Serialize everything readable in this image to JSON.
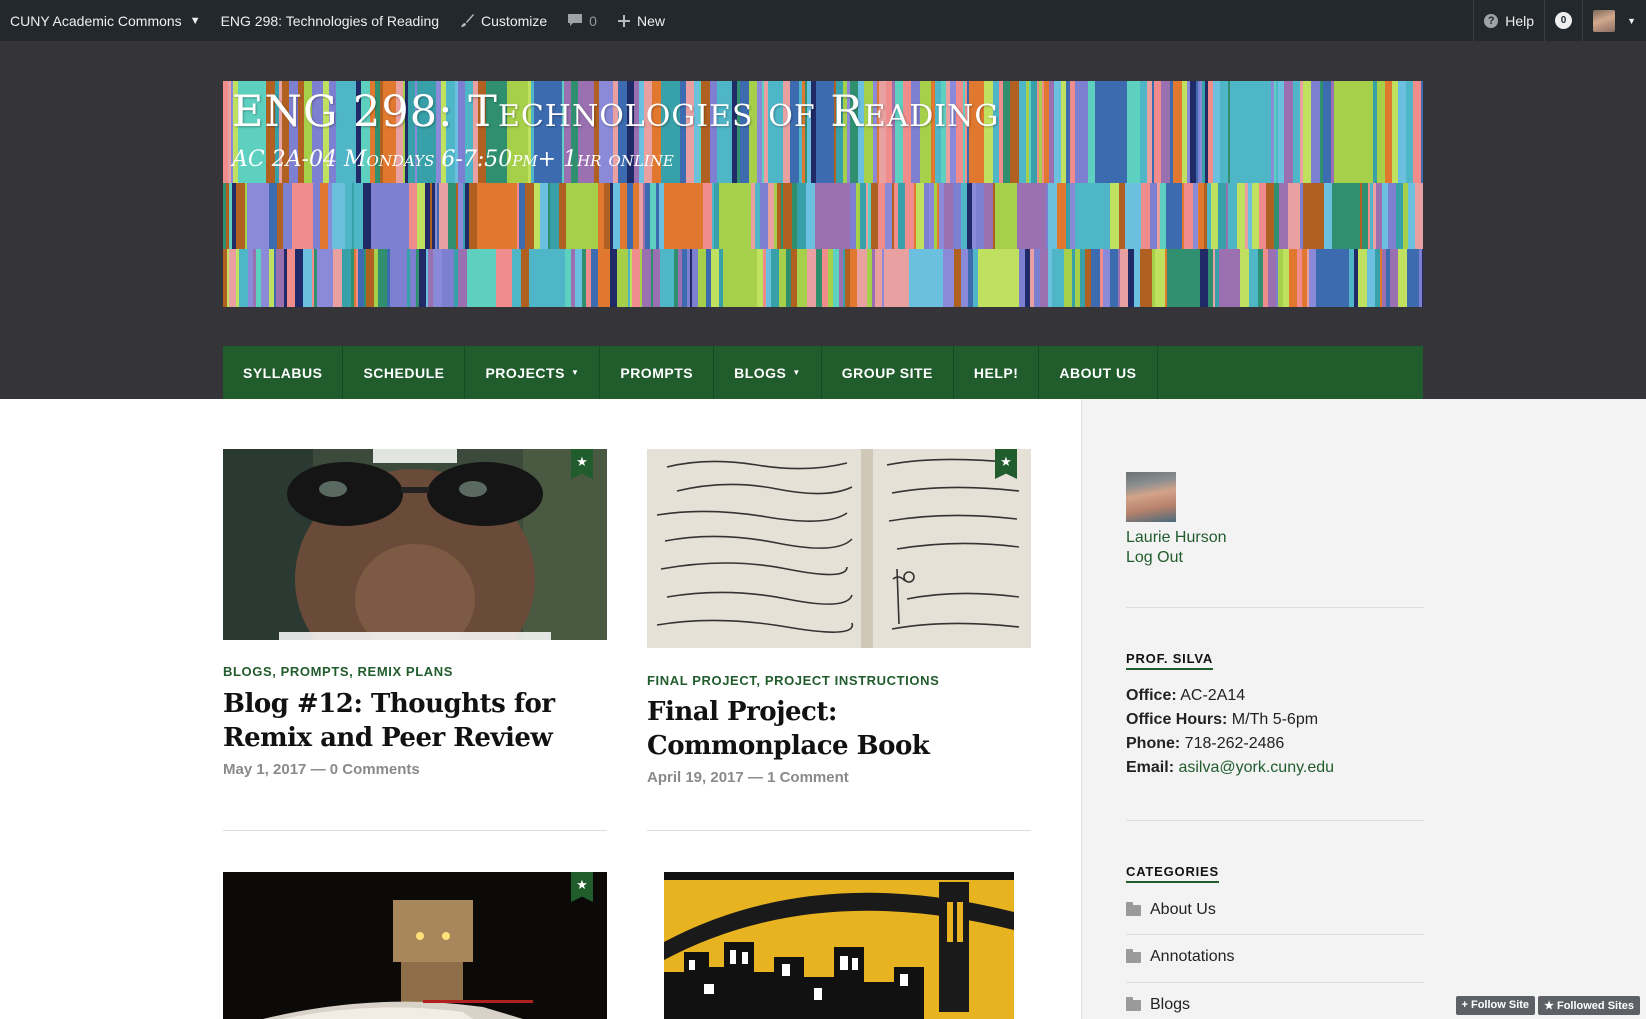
{
  "adminbar": {
    "site_name": "CUNY Academic Commons",
    "course_link": "ENG 298: Technologies of Reading",
    "customize": "Customize",
    "comments_count": "0",
    "new": "New",
    "help": "Help",
    "notifications_count": "0"
  },
  "header": {
    "title": "ENG 298: Technologies of Reading",
    "description": "AC 2A-04 Mondays 6-7:50pm+ 1hr online"
  },
  "nav": {
    "items": [
      {
        "label": "SYLLABUS"
      },
      {
        "label": "SCHEDULE"
      },
      {
        "label": "PROJECTS"
      },
      {
        "label": "PROMPTS"
      },
      {
        "label": "BLOGS"
      },
      {
        "label": "GROUP SITE"
      },
      {
        "label": "HELP!"
      },
      {
        "label": "ABOUT US"
      }
    ]
  },
  "posts": [
    {
      "categories": "BLOGS, PROMPTS, REMIX PLANS",
      "title": "Blog #12: Thoughts for Remix and Peer Review",
      "date": "May 1, 2017",
      "comments": "0 Comments"
    },
    {
      "categories": "FINAL PROJECT, PROJECT INSTRUCTIONS",
      "title": "Final Project: Commonplace Book",
      "date": "April 19, 2017",
      "comments": "1 Comment"
    }
  ],
  "sidebar": {
    "user_name": "Laurie Hurson",
    "logout": "Log Out",
    "prof_title": "PROF. SILVA",
    "office_label": "Office:",
    "office_value": "AC-2A14",
    "hours_label": "Office Hours:",
    "hours_value": "M/Th 5-6pm",
    "phone_label": "Phone:",
    "phone_value": "718-262-2486",
    "email_label": "Email:",
    "email_value": "asilva@york.cuny.edu",
    "categories_title": "CATEGORIES",
    "categories": [
      "About Us",
      "Annotations",
      "Blogs"
    ]
  },
  "follow": {
    "follow_site": "+ Follow Site",
    "followed_sites": "★ Followed Sites"
  },
  "colors": {
    "adminbar": "#23282d",
    "header_bg": "#353539",
    "nav_green": "#215c2d",
    "link_green": "#215c2d"
  }
}
